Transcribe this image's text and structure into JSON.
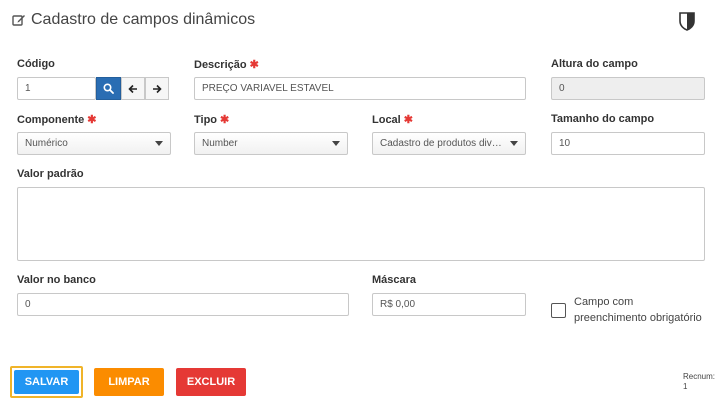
{
  "header": {
    "title": "Cadastro de campos dinâmicos"
  },
  "fields": {
    "codigo": {
      "label": "Código",
      "value": "1"
    },
    "descricao": {
      "label": "Descrição",
      "required": "✱",
      "value": "PREÇO VARIAVEL ESTAVEL"
    },
    "altura": {
      "label": "Altura do campo",
      "value": "0"
    },
    "componente": {
      "label": "Componente",
      "required": "✱",
      "value": "Numérico"
    },
    "tipo": {
      "label": "Tipo",
      "required": "✱",
      "value": "Number"
    },
    "local": {
      "label": "Local",
      "required": "✱",
      "value": "Cadastro de produtos diversos"
    },
    "tamanho": {
      "label": "Tamanho do campo",
      "value": "10"
    },
    "valor_padrao": {
      "label": "Valor padrão",
      "value": ""
    },
    "valor_banco": {
      "label": "Valor no banco",
      "value": "0"
    },
    "mascara": {
      "label": "Máscara",
      "value": "R$ 0,00"
    },
    "obrigatorio": {
      "label_line1": "Campo com",
      "label_line2": "preenchimento obrigatório",
      "checked": false
    }
  },
  "buttons": {
    "salvar": {
      "label": "SALVAR",
      "color": "#2196f3"
    },
    "limpar": {
      "label": "LIMPAR",
      "color": "#fb8c00"
    },
    "excluir": {
      "label": "EXCLUIR",
      "color": "#e53935"
    }
  },
  "footer": {
    "recnum_label": "Recnum:",
    "recnum_value": "1"
  },
  "icons": {
    "title_icon": "edit-icon",
    "search": "search-icon",
    "prev": "arrow-left-icon",
    "next": "arrow-right-icon",
    "shield": "shield-icon"
  }
}
